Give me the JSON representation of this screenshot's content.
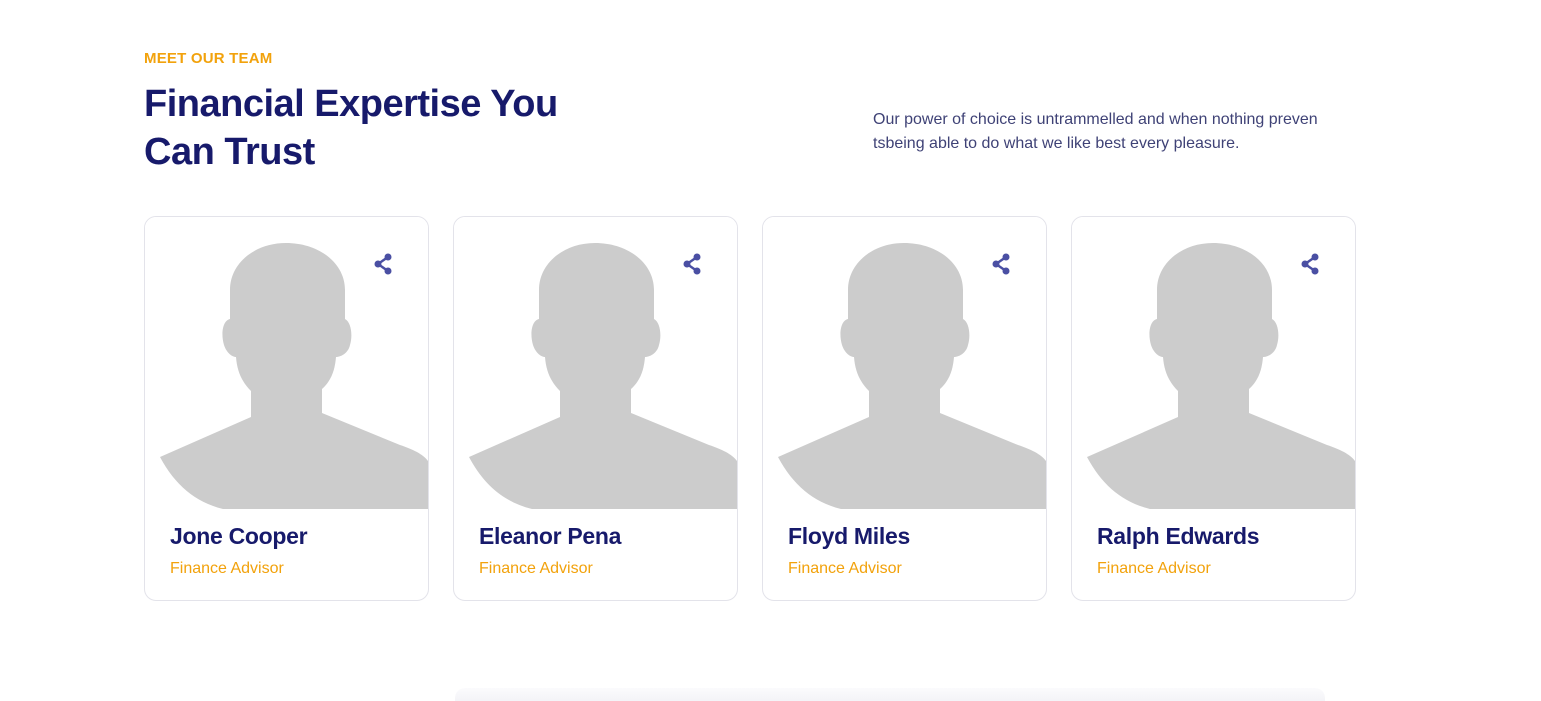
{
  "section": {
    "eyebrow": "MEET OUR TEAM",
    "title": "Financial Expertise You Can Trust",
    "description": "Our power of choice is untrammelled and when nothing preven tsbeing able to do what we like best every pleasure."
  },
  "team": [
    {
      "name": "Jone Cooper",
      "role": "Finance Advisor"
    },
    {
      "name": "Eleanor Pena",
      "role": "Finance Advisor"
    },
    {
      "name": "Floyd Miles",
      "role": "Finance Advisor"
    },
    {
      "name": "Ralph Edwards",
      "role": "Finance Advisor"
    }
  ],
  "icons": {
    "share": "share-icon",
    "avatar": "avatar-placeholder"
  },
  "colors": {
    "accent": "#f2a20c",
    "heading": "#171a6b",
    "body_text": "#3f4276",
    "share_icon": "#4a4fa3",
    "placeholder": "#cccccc"
  }
}
